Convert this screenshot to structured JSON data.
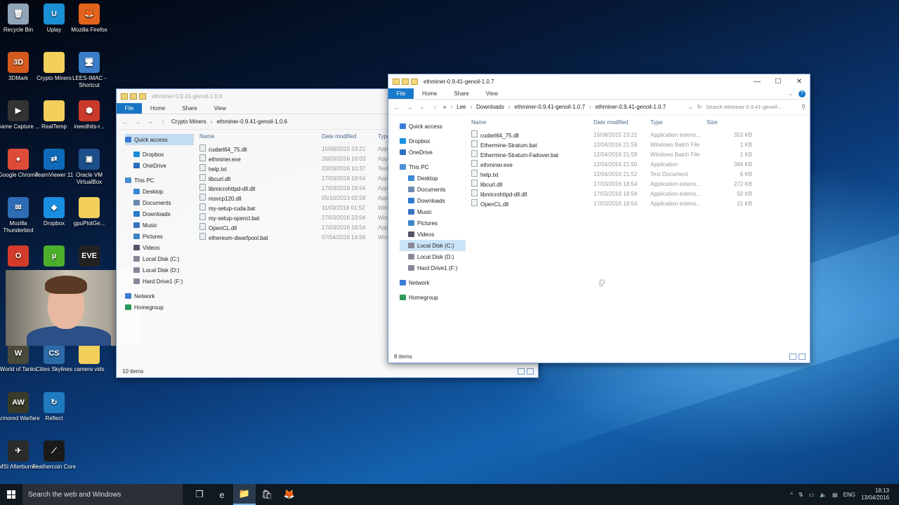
{
  "desktop_icons": [
    {
      "label": "Recycle Bin",
      "color": "#8fa4b8",
      "glyph": "🗑",
      "icon": "recycle-bin-icon"
    },
    {
      "label": "Uplay",
      "color": "#1a8fd6",
      "glyph": "U",
      "icon": "uplay-icon"
    },
    {
      "label": "Mozilla Firefox",
      "color": "#e2641c",
      "glyph": "🦊",
      "icon": "firefox-icon"
    },
    {
      "label": "3DMark",
      "color": "#d45a1e",
      "glyph": "3D",
      "icon": "3dmark-icon"
    },
    {
      "label": "Crypto Miners",
      "color": "#f2cf5b",
      "glyph": "",
      "icon": "folder-icon"
    },
    {
      "label": "LEES-IMAC - Shortcut",
      "color": "#3a7cc8",
      "glyph": "🖥",
      "icon": "computer-icon"
    },
    {
      "label": "Game Capture ...",
      "color": "#333",
      "glyph": "▶",
      "icon": "game-capture-icon"
    },
    {
      "label": "RealTemp",
      "color": "#f2cf5b",
      "glyph": "",
      "icon": "folder-icon"
    },
    {
      "label": "ineedhits-r...",
      "color": "#c93a2a",
      "glyph": "⬢",
      "icon": "ineedhits-icon"
    },
    {
      "label": "Google Chrome",
      "color": "#dd4b39",
      "glyph": "●",
      "icon": "chrome-icon"
    },
    {
      "label": "TeamViewer 11",
      "color": "#0e6ab8",
      "glyph": "⇄",
      "icon": "teamviewer-icon"
    },
    {
      "label": "Oracle VM VirtualBox",
      "color": "#1b4f8a",
      "glyph": "▣",
      "icon": "virtualbox-icon"
    },
    {
      "label": "Mozilla Thunderbird",
      "color": "#2f6cb6",
      "glyph": "✉",
      "icon": "thunderbird-icon"
    },
    {
      "label": "Dropbox",
      "color": "#1a8fe0",
      "glyph": "◆",
      "icon": "dropbox-icon"
    },
    {
      "label": "gpuPlotGe...",
      "color": "#f2cf5b",
      "glyph": "",
      "icon": "folder-icon"
    },
    {
      "label": "",
      "color": "#d33b2a",
      "glyph": "O",
      "icon": "origin-icon"
    },
    {
      "label": "",
      "color": "#4caf2c",
      "glyph": "µ",
      "icon": "utorrent-icon"
    },
    {
      "label": "",
      "color": "#222",
      "glyph": "EVE",
      "icon": "eve-icon"
    },
    {
      "label": "World of Tanks",
      "color": "#4a4a3a",
      "glyph": "W",
      "icon": "world-of-tanks-icon"
    },
    {
      "label": "Cities Skylines",
      "color": "#2c6aa8",
      "glyph": "CS",
      "icon": "cities-skylines-icon"
    },
    {
      "label": "camera vids",
      "color": "#f2cf5b",
      "glyph": "",
      "icon": "folder-icon"
    },
    {
      "label": "Armored Warfare",
      "color": "#3a3a2a",
      "glyph": "AW",
      "icon": "armored-warfare-icon"
    },
    {
      "label": "Reflect",
      "color": "#1f7ac0",
      "glyph": "↻",
      "icon": "reflect-icon"
    },
    {
      "label": "MSI Afterburner",
      "color": "#2b2b2b",
      "glyph": "✈",
      "icon": "msi-afterburner-icon"
    },
    {
      "label": "Feathercoin Core",
      "color": "#1a1a1a",
      "glyph": "⟋",
      "icon": "feathercoin-icon"
    }
  ],
  "back_window": {
    "title": "ethminer-0.9.41-genoil-1.0.6",
    "ribbon": {
      "file": "File",
      "tabs": [
        "Home",
        "Share",
        "View"
      ]
    },
    "breadcrumbs": [
      "Crypto Miners",
      "ethminer-0.9.41-genoil-1.0.6"
    ],
    "nav": [
      {
        "label": "Quick access",
        "icon": "star-icon",
        "color": "#3b7dd8",
        "level": 0,
        "selected": true
      },
      {
        "label": "Dropbox",
        "icon": "dropbox-icon",
        "color": "#1a8fe0",
        "level": 1
      },
      {
        "label": "OneDrive",
        "icon": "onedrive-icon",
        "color": "#2d6fc2",
        "level": 1
      },
      {
        "label": "This PC",
        "icon": "pc-icon",
        "color": "#4a8fd8",
        "level": 0
      },
      {
        "label": "Desktop",
        "icon": "desktop-icon",
        "color": "#3a8ad8",
        "level": 1
      },
      {
        "label": "Documents",
        "icon": "documents-icon",
        "color": "#6e8bb0",
        "level": 1
      },
      {
        "label": "Downloads",
        "icon": "downloads-icon",
        "color": "#2c7bd0",
        "level": 1
      },
      {
        "label": "Music",
        "icon": "music-icon",
        "color": "#3a74c0",
        "level": 1
      },
      {
        "label": "Pictures",
        "icon": "pictures-icon",
        "color": "#3f86c8",
        "level": 1
      },
      {
        "label": "Videos",
        "icon": "videos-icon",
        "color": "#556",
        "level": 1
      },
      {
        "label": "Local Disk (C:)",
        "icon": "disk-icon",
        "color": "#889",
        "level": 1
      },
      {
        "label": "Local Disk (D:)",
        "icon": "disk-icon",
        "color": "#889",
        "level": 1
      },
      {
        "label": "Hard Drive1 (F:)",
        "icon": "disk-icon",
        "color": "#889",
        "level": 1
      },
      {
        "label": "Network",
        "icon": "network-icon",
        "color": "#3b7dd8",
        "level": 0
      },
      {
        "label": "Homegroup",
        "icon": "homegroup-icon",
        "color": "#2c9a5a",
        "level": 0
      }
    ],
    "columns": [
      "Name",
      "Date modified",
      "Type"
    ],
    "files": [
      {
        "name": "cudart64_75.dll",
        "date": "15/08/2015 23:21",
        "type": "Appl"
      },
      {
        "name": "ethminer.exe",
        "date": "26/03/2016 10:03",
        "type": "Appl"
      },
      {
        "name": "help.txt",
        "date": "23/03/2016 10:37",
        "type": "Text"
      },
      {
        "name": "libcurl.dll",
        "date": "17/03/2016 18:54",
        "type": "Appl"
      },
      {
        "name": "libmicrohttpd-dll.dll",
        "date": "17/03/2016 18:54",
        "type": "Appl"
      },
      {
        "name": "msvcp120.dll",
        "date": "05/10/2013 02:58",
        "type": "Appl"
      },
      {
        "name": "my-setup-cuda.bat",
        "date": "11/03/2016 01:52",
        "type": "Win"
      },
      {
        "name": "my-setup-opencl.bat",
        "date": "27/03/2016 23:04",
        "type": "Win"
      },
      {
        "name": "OpenCL.dll",
        "date": "17/03/2016 18:54",
        "type": "Appl"
      },
      {
        "name": "ethereum-dwarfpool.bat",
        "date": "07/04/2016 14:56",
        "type": "Win"
      }
    ],
    "status": "10 items"
  },
  "front_window": {
    "title": "ethminer-0.9.41-genoil-1.0.7",
    "ribbon": {
      "file": "File",
      "tabs": [
        "Home",
        "Share",
        "View"
      ]
    },
    "breadcrumbs": [
      "«",
      "Lee",
      "Downloads",
      "ethminer-0.9.41-genoil-1.0.7",
      "ethminer-0.9.41-genoil-1.0.7"
    ],
    "search_placeholder": "Search ethminer-0.9.41-genoil-...",
    "nav": [
      {
        "label": "Quick access",
        "icon": "star-icon",
        "color": "#3b7dd8",
        "level": 0
      },
      {
        "label": "Dropbox",
        "icon": "dropbox-icon",
        "color": "#1a8fe0",
        "level": 0
      },
      {
        "label": "OneDrive",
        "icon": "onedrive-icon",
        "color": "#2d6fc2",
        "level": 0
      },
      {
        "label": "This PC",
        "icon": "pc-icon",
        "color": "#4a8fd8",
        "level": 0
      },
      {
        "label": "Desktop",
        "icon": "desktop-icon",
        "color": "#3a8ad8",
        "level": 1
      },
      {
        "label": "Documents",
        "icon": "documents-icon",
        "color": "#6e8bb0",
        "level": 1
      },
      {
        "label": "Downloads",
        "icon": "downloads-icon",
        "color": "#2c7bd0",
        "level": 1
      },
      {
        "label": "Music",
        "icon": "music-icon",
        "color": "#3a74c0",
        "level": 1
      },
      {
        "label": "Pictures",
        "icon": "pictures-icon",
        "color": "#3f86c8",
        "level": 1
      },
      {
        "label": "Videos",
        "icon": "videos-icon",
        "color": "#556",
        "level": 1
      },
      {
        "label": "Local Disk (C:)",
        "icon": "disk-icon",
        "color": "#889",
        "level": 1,
        "selected": true
      },
      {
        "label": "Local Disk (D:)",
        "icon": "disk-icon",
        "color": "#889",
        "level": 1
      },
      {
        "label": "Hard Drive1 (F:)",
        "icon": "disk-icon",
        "color": "#889",
        "level": 1
      },
      {
        "label": "Network",
        "icon": "network-icon",
        "color": "#3b7dd8",
        "level": 0
      },
      {
        "label": "Homegroup",
        "icon": "homegroup-icon",
        "color": "#2c9a5a",
        "level": 0
      }
    ],
    "columns": [
      "Name",
      "Date modified",
      "Type",
      "Size"
    ],
    "files": [
      {
        "name": "cudart64_75.dll",
        "date": "15/08/2015 23:21",
        "type": "Application extens...",
        "size": "353 KB"
      },
      {
        "name": "Ethermine-Stratum.bat",
        "date": "12/04/2016 21:59",
        "type": "Windows Batch File",
        "size": "1 KB"
      },
      {
        "name": "Ethermine-Stratum-Failover.bat",
        "date": "12/04/2016 21:59",
        "type": "Windows Batch File",
        "size": "1 KB"
      },
      {
        "name": "ethminer.exe",
        "date": "12/04/2016 21:50",
        "type": "Application",
        "size": "384 KB"
      },
      {
        "name": "help.txt",
        "date": "12/04/2016 21:52",
        "type": "Text Document",
        "size": "6 KB"
      },
      {
        "name": "libcurl.dll",
        "date": "17/03/2016 18:54",
        "type": "Application extens...",
        "size": "272 KB"
      },
      {
        "name": "libmicrohttpd-dll.dll",
        "date": "17/03/2016 18:54",
        "type": "Application extens...",
        "size": "92 KB"
      },
      {
        "name": "OpenCL.dll",
        "date": "17/03/2016 18:54",
        "type": "Application extens...",
        "size": "21 KB"
      }
    ],
    "status": "8 items"
  },
  "taskbar": {
    "search_placeholder": "Search the web and Windows",
    "apps": [
      {
        "icon": "task-view-icon",
        "glyph": "❐"
      },
      {
        "icon": "edge-icon",
        "glyph": "e"
      },
      {
        "icon": "file-explorer-icon",
        "glyph": "📁",
        "active": true
      },
      {
        "icon": "store-icon",
        "glyph": "🛍"
      },
      {
        "icon": "firefox-icon",
        "glyph": "🦊"
      }
    ],
    "language": "ENG",
    "time": "18:13",
    "date": "13/04/2016"
  }
}
